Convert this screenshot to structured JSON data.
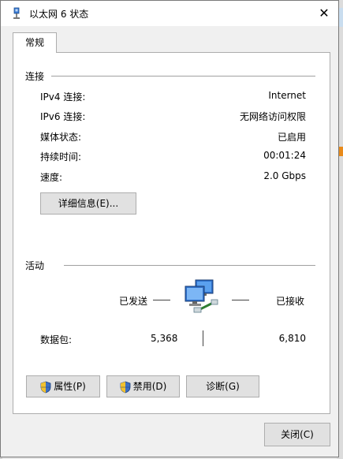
{
  "window": {
    "title": "以太网 6 状态",
    "close_glyph": "✕"
  },
  "tabs": [
    {
      "label": "常规"
    }
  ],
  "connection": {
    "section_title": "连接",
    "rows": [
      {
        "label": "IPv4 连接:",
        "value": "Internet"
      },
      {
        "label": "IPv6 连接:",
        "value": "无网络访问权限"
      },
      {
        "label": "媒体状态:",
        "value": "已启用"
      },
      {
        "label": "持续时间:",
        "value": "00:01:24"
      },
      {
        "label": "速度:",
        "value": "2.0 Gbps"
      }
    ],
    "details_button": "详细信息(E)..."
  },
  "activity": {
    "section_title": "活动",
    "sent_label": "已发送",
    "received_label": "已接收",
    "packets_label": "数据包:",
    "packets_sent": "5,368",
    "packets_received": "6,810"
  },
  "buttons": {
    "properties": "属性(P)",
    "disable": "禁用(D)",
    "diagnose": "诊断(G)",
    "close": "关闭(C)"
  },
  "icons": {
    "title": "network-adapter-icon",
    "activity": "network-computers-icon",
    "shield": "uac-shield-icon"
  }
}
